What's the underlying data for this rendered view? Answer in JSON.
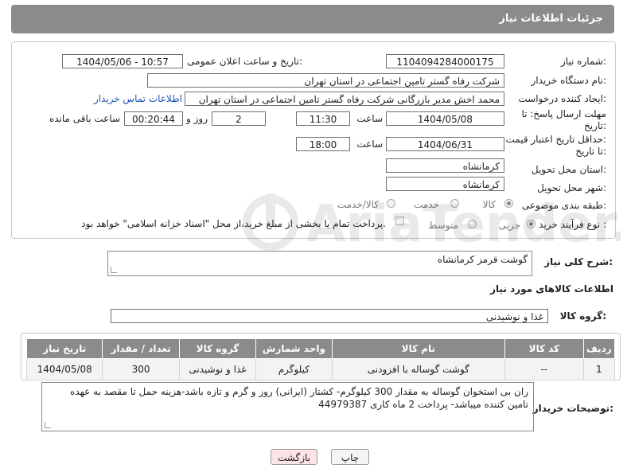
{
  "header": {
    "title": "جزئیات اطلاعات نیاز"
  },
  "form": {
    "need_number_label": "شماره نیاز:",
    "need_number": "1104094284000175",
    "announce_label": "تاریخ و ساعت اعلان عمومی:",
    "announce_value": "1404/05/06 - 10:57",
    "buyer_org_label": "نام دستگاه خریدار:",
    "buyer_org": "شرکت رفاه گستر تامین اجتماعی در استان تهران",
    "creator_label": "ایجاد کننده درخواست:",
    "creator": "محمد اخش مدیر بازرگانی شرکت رفاه گستر تامین اجتماعی در استان تهران",
    "contact_link": "اطلاعات تماس خریدار",
    "deadline_label_1": "مهلت ارسال پاسخ: تا",
    "deadline_label_2": "تاریخ:",
    "deadline_date": "1404/05/08",
    "time_label": "ساعت",
    "deadline_time": "11:30",
    "days_value": "2",
    "days_label": "روز و",
    "remaining_time": "00:20:44",
    "remaining_label": "ساعت باقی مانده",
    "min_price_label_1": "حداقل تاریخ اعتبار قیمت:",
    "min_price_label_2": "تا تاریخ:",
    "price_date": "1404/06/31",
    "price_time_label": "ساعت",
    "price_time": "18:00",
    "province_label": "استان محل تحویل:",
    "province": "کرمانشاه",
    "city_label": "شهر محل تحویل:",
    "city": "کرمانشاه",
    "category_label": "طبقه بندی موضوعی:",
    "category_options": [
      "کالا",
      "خدمت",
      "کالا/خدمت"
    ],
    "purchase_type_label": "نوع فرآیند خرید :",
    "purchase_options": [
      "جزیی",
      "متوسط"
    ],
    "payment_note": "پرداخت تمام یا بخشی از مبلغ خرید،از محل \"اسناد خزانه اسلامی\" خواهد بود."
  },
  "description": {
    "label": "شرح کلی نیاز:",
    "value": "گوشت قرمز کرمانشاه"
  },
  "goods": {
    "section_title": "اطلاعات کالاهای مورد نیاز",
    "group_label": "گروه کالا:",
    "group_value": "غذا و نوشیدنی",
    "columns": [
      "ردیف",
      "کد کالا",
      "نام کالا",
      "واحد شمارش",
      "گروه کالا",
      "تعداد / مقدار",
      "تاریخ نیاز"
    ],
    "rows": [
      [
        "1",
        "--",
        "گوشت گوساله با افزودنی",
        "کیلوگرم",
        "غذا و نوشیدنی",
        "300",
        "1404/05/08"
      ]
    ]
  },
  "buyer_notes": {
    "label": "توضیحات خریدار:",
    "value": "ران بی استخوان گوساله به مقدار 300 کیلوگرم- کشتار (ایرانی) روز و گرم و تازه باشد-هزینه حمل تا مقصد به عهده تامین کننده میباشد- پرداخت 2 ماه کاری 44979387"
  },
  "buttons": {
    "print": "چاپ",
    "back": "بازگشت"
  },
  "watermark": {
    "text": "AriaTender.neT"
  },
  "colors": {
    "header": "#8b8b8b",
    "link": "#1a56b0",
    "back_button": "#fde4e4"
  }
}
